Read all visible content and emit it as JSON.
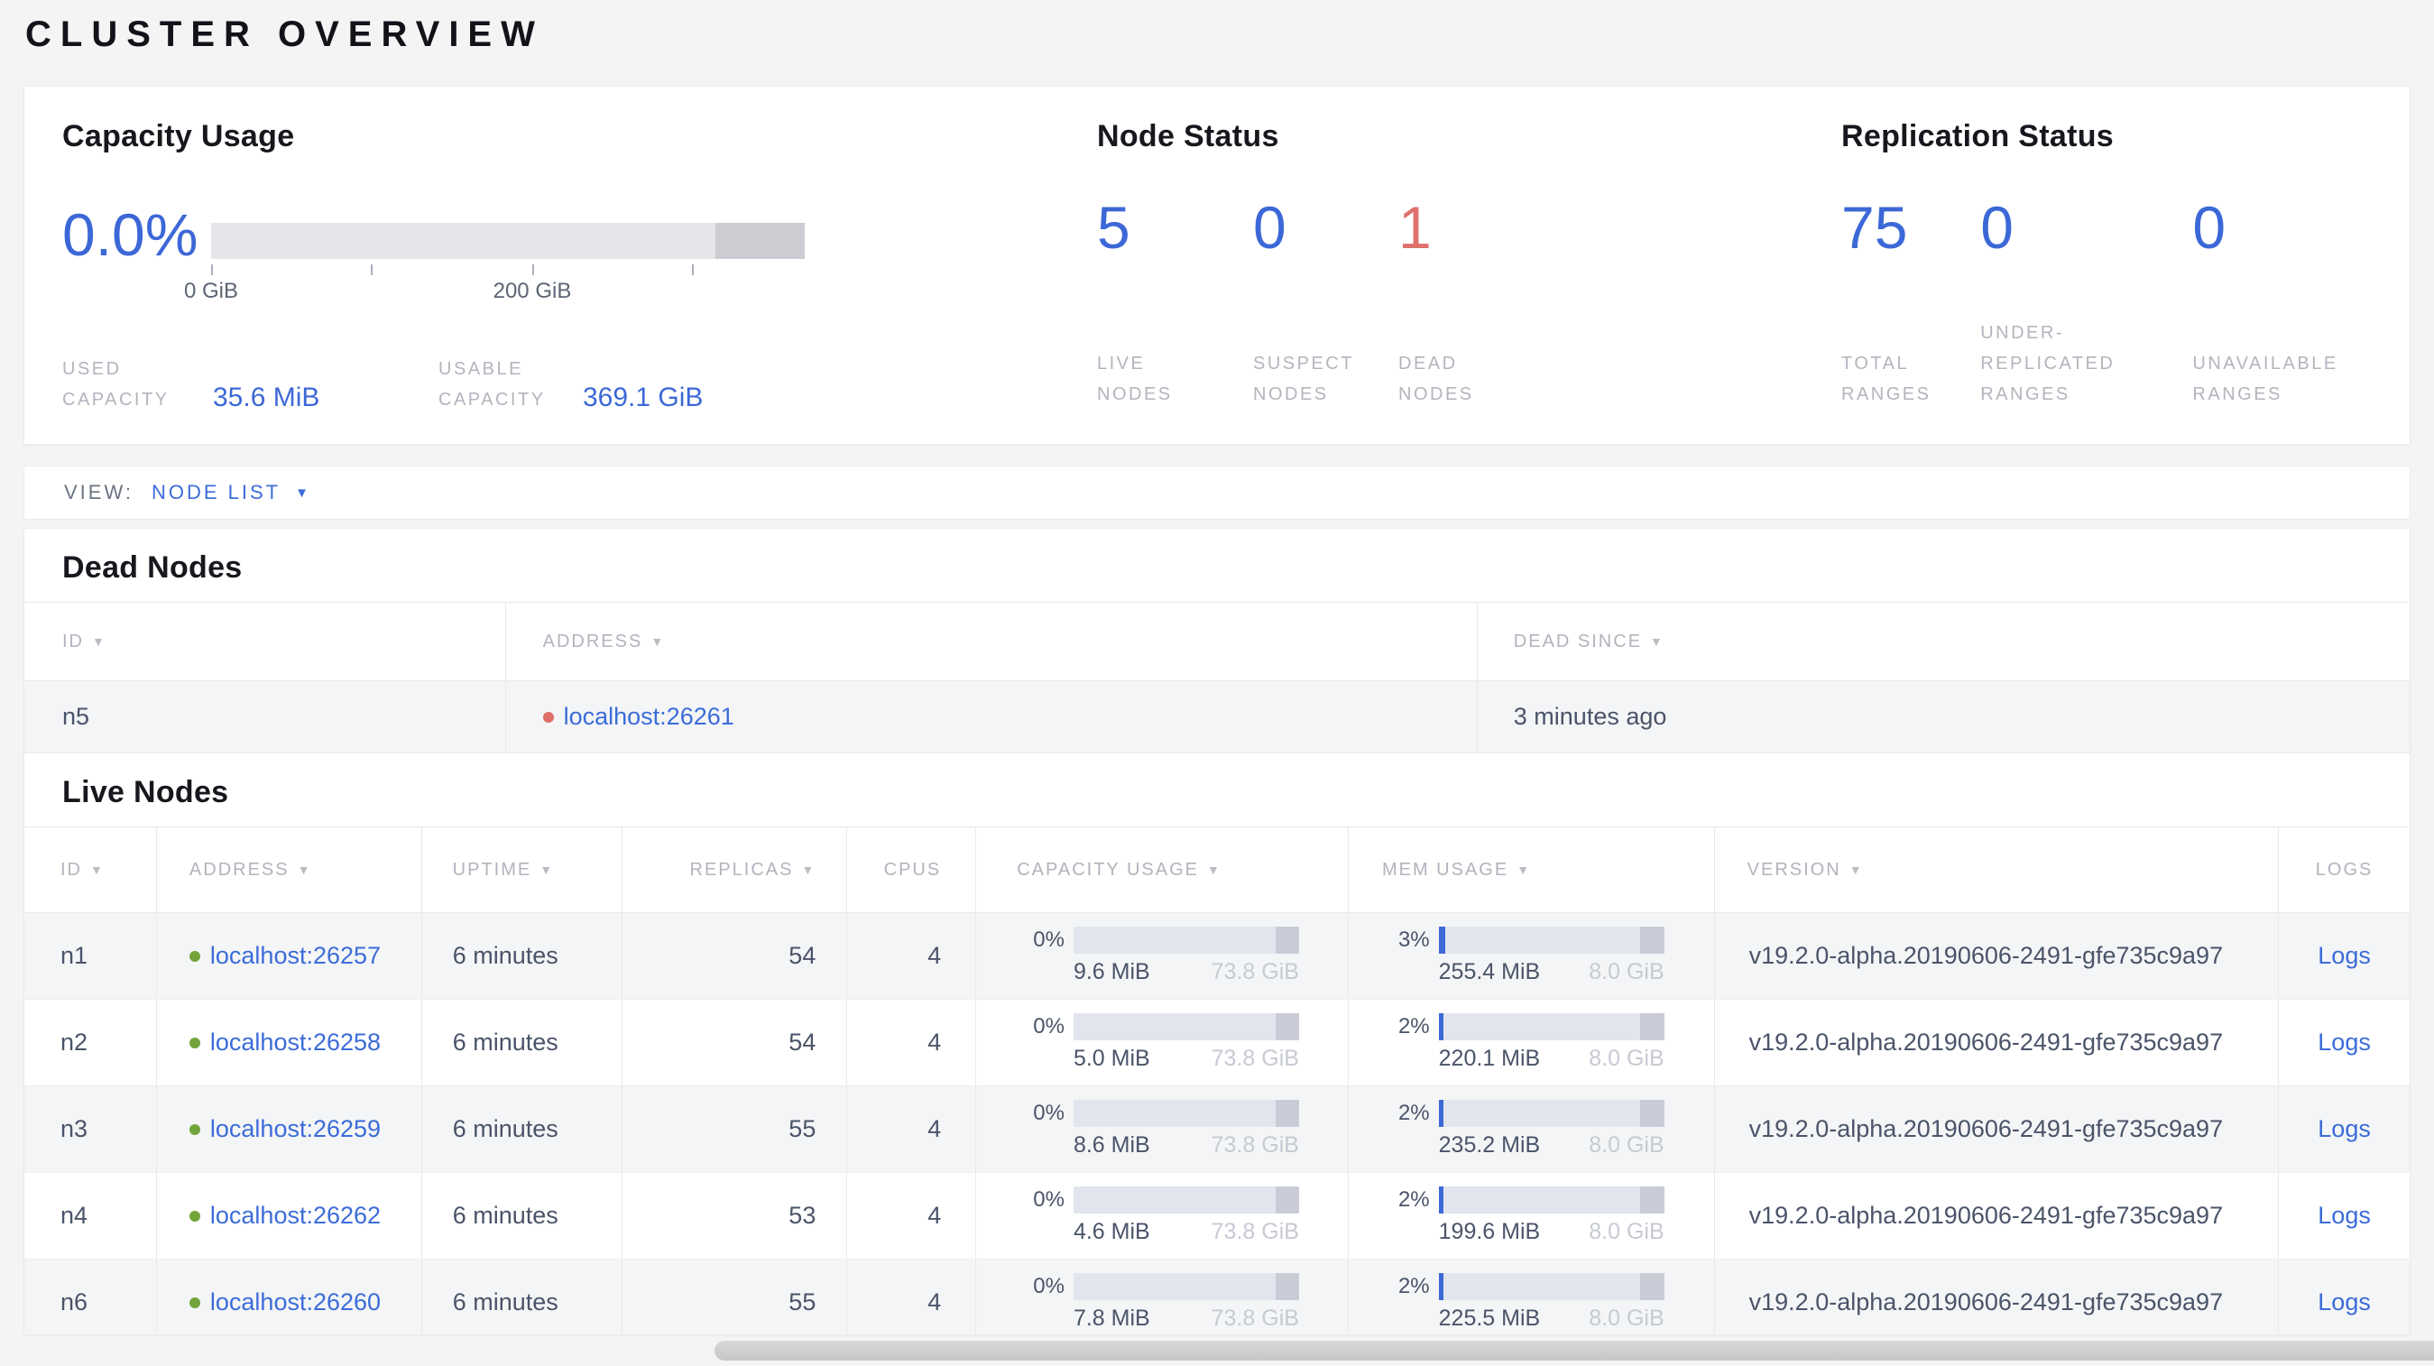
{
  "page_title": "CLUSTER OVERVIEW",
  "colors": {
    "accent_blue": "#3b6cd9",
    "stat_blue": "#3c68d7",
    "dead_red": "#df706d",
    "live_green_dot": "#72a43b",
    "dead_red_dot": "#de6e66",
    "muted_label_gray": "#b2b5bd",
    "value_slate": "#4a5469",
    "bar_track": "#e3e5ee",
    "bar_reserved": "#c9ccd6"
  },
  "summary": {
    "capacity": {
      "title": "Capacity Usage",
      "percent": "0.0%",
      "tick_labels": [
        "0 GiB",
        "200 GiB"
      ],
      "used_label": "USED CAPACITY",
      "used_value": "35.6 MiB",
      "usable_label": "USABLE CAPACITY",
      "usable_value": "369.1 GiB"
    },
    "node_status": {
      "title": "Node Status",
      "stats": [
        {
          "value": "5",
          "label": "LIVE NODES",
          "tone": "blue"
        },
        {
          "value": "0",
          "label": "SUSPECT NODES",
          "tone": "blue"
        },
        {
          "value": "1",
          "label": "DEAD NODES",
          "tone": "red"
        }
      ]
    },
    "replication": {
      "title": "Replication Status",
      "stats": [
        {
          "value": "75",
          "label": "TOTAL RANGES",
          "tone": "blue"
        },
        {
          "value": "0",
          "label": "UNDER-REPLICATED RANGES",
          "tone": "blue"
        },
        {
          "value": "0",
          "label": "UNAVAILABLE RANGES",
          "tone": "blue"
        }
      ]
    }
  },
  "view_bar": {
    "label": "VIEW:",
    "selected": "NODE LIST"
  },
  "dead_nodes": {
    "title": "Dead Nodes",
    "columns": [
      {
        "label": "ID",
        "sortable": true
      },
      {
        "label": "ADDRESS",
        "sortable": true
      },
      {
        "label": "DEAD SINCE",
        "sortable": true
      }
    ],
    "rows": [
      {
        "id": "n5",
        "address": "localhost:26261",
        "dead_since": "3 minutes ago"
      }
    ]
  },
  "live_nodes": {
    "title": "Live Nodes",
    "logs_label": "Logs",
    "columns": [
      {
        "label": "ID",
        "sortable": true
      },
      {
        "label": "ADDRESS",
        "sortable": true
      },
      {
        "label": "UPTIME",
        "sortable": true
      },
      {
        "label": "REPLICAS",
        "sortable": true
      },
      {
        "label": "CPUS",
        "sortable": false
      },
      {
        "label": "CAPACITY USAGE",
        "sortable": true
      },
      {
        "label": "MEM USAGE",
        "sortable": true
      },
      {
        "label": "VERSION",
        "sortable": true
      },
      {
        "label": "LOGS",
        "sortable": false
      }
    ],
    "rows": [
      {
        "id": "n1",
        "address": "localhost:26257",
        "uptime": "6 minutes",
        "replicas": "54",
        "cpus": "4",
        "capacity": {
          "pct": "0%",
          "used": "9.6 MiB",
          "total": "73.8 GiB"
        },
        "mem": {
          "pct": "3%",
          "used": "255.4 MiB",
          "total": "8.0 GiB"
        },
        "version": "v19.2.0-alpha.20190606-2491-gfe735c9a97"
      },
      {
        "id": "n2",
        "address": "localhost:26258",
        "uptime": "6 minutes",
        "replicas": "54",
        "cpus": "4",
        "capacity": {
          "pct": "0%",
          "used": "5.0 MiB",
          "total": "73.8 GiB"
        },
        "mem": {
          "pct": "2%",
          "used": "220.1 MiB",
          "total": "8.0 GiB"
        },
        "version": "v19.2.0-alpha.20190606-2491-gfe735c9a97"
      },
      {
        "id": "n3",
        "address": "localhost:26259",
        "uptime": "6 minutes",
        "replicas": "55",
        "cpus": "4",
        "capacity": {
          "pct": "0%",
          "used": "8.6 MiB",
          "total": "73.8 GiB"
        },
        "mem": {
          "pct": "2%",
          "used": "235.2 MiB",
          "total": "8.0 GiB"
        },
        "version": "v19.2.0-alpha.20190606-2491-gfe735c9a97"
      },
      {
        "id": "n4",
        "address": "localhost:26262",
        "uptime": "6 minutes",
        "replicas": "53",
        "cpus": "4",
        "capacity": {
          "pct": "0%",
          "used": "4.6 MiB",
          "total": "73.8 GiB"
        },
        "mem": {
          "pct": "2%",
          "used": "199.6 MiB",
          "total": "8.0 GiB"
        },
        "version": "v19.2.0-alpha.20190606-2491-gfe735c9a97"
      },
      {
        "id": "n6",
        "address": "localhost:26260",
        "uptime": "6 minutes",
        "replicas": "55",
        "cpus": "4",
        "capacity": {
          "pct": "0%",
          "used": "7.8 MiB",
          "total": "73.8 GiB"
        },
        "mem": {
          "pct": "2%",
          "used": "225.5 MiB",
          "total": "8.0 GiB"
        },
        "version": "v19.2.0-alpha.20190606-2491-gfe735c9a97"
      }
    ]
  }
}
